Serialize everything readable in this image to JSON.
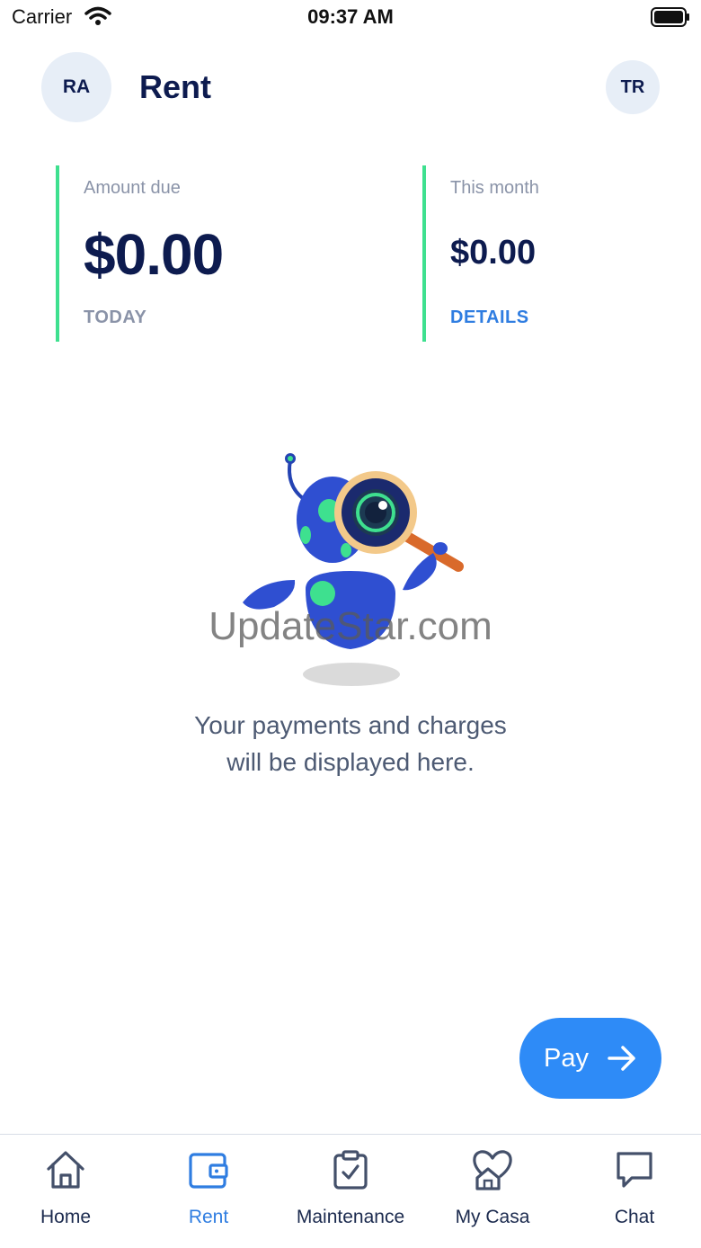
{
  "status_bar": {
    "carrier": "Carrier",
    "time": "09:37 AM"
  },
  "header": {
    "title": "Rent",
    "left_avatar": "RA",
    "right_avatar": "TR"
  },
  "summary": {
    "amount_due": {
      "label": "Amount due",
      "value": "$0.00",
      "footer": "TODAY"
    },
    "this_month": {
      "label": "This month",
      "value": "$0.00",
      "link": "DETAILS"
    }
  },
  "watermark": "UpdateStar.com",
  "empty_state": {
    "line1": "Your payments and charges",
    "line2": "will be displayed here."
  },
  "pay_button": {
    "label": "Pay"
  },
  "tab_bar": {
    "items": [
      {
        "label": "Home",
        "icon": "home-icon"
      },
      {
        "label": "Rent",
        "icon": "wallet-icon",
        "active": true
      },
      {
        "label": "Maintenance",
        "icon": "clipboard-check-icon"
      },
      {
        "label": "My Casa",
        "icon": "heart-house-icon"
      },
      {
        "label": "Chat",
        "icon": "chat-bubble-icon"
      }
    ]
  },
  "colors": {
    "accent": "#2e8bf7",
    "card_border": "#3ee08f",
    "navy": "#0d1b4f",
    "muted": "#8a93a8"
  }
}
